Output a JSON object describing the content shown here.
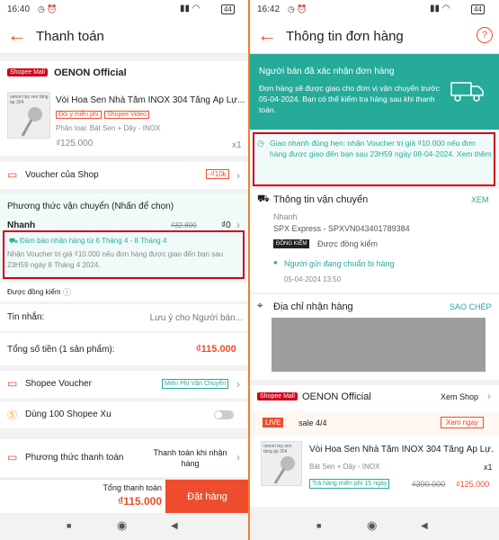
{
  "left": {
    "status_time": "16:40",
    "status_icons": "◷ ⏰",
    "battery": "44",
    "title": "Thanh toán",
    "shop": {
      "badge": "Shopee Mall",
      "name": "OENON Official"
    },
    "product": {
      "name": "Vòi Hoa Sen Nhà Tắm INOX 304 Tăng Áp Lự...",
      "tag1": "Đổi ý miễn phí",
      "tag2": "Shopee Video",
      "variant": "Phân loại: Bát Sen + Dây - INOX",
      "price": "₫125.000",
      "qty": "x1",
      "thumb_text": "oenon tay sen tăng áp 304"
    },
    "voucher_shop": {
      "label": "Voucher của Shop",
      "badge": "-₫10k"
    },
    "shipping": {
      "title": "Phương thức vận chuyển (Nhấn để chọn)",
      "method": "Nhanh",
      "old_price": "₫32.800",
      "price": "₫0",
      "guarantee": "Đảm bảo nhận hàng từ 6 Tháng 4 - 8 Tháng 4",
      "note": "Nhận Voucher trị giá ₫10.000 nếu đơn hàng được giao đến bạn sau 23H59 ngày 8 Tháng 4 2024."
    },
    "inspect": "Được đồng kiểm",
    "message": {
      "label": "Tin nhắn:",
      "placeholder": "Lưu ý cho Người bán..."
    },
    "total_line": {
      "label": "Tổng số tiền (1 sản phẩm):",
      "value": "₫115.000"
    },
    "shopee_voucher": {
      "label": "Shopee Voucher",
      "badge": "Miễn Phí Vận Chuyển"
    },
    "xu": {
      "label": "Dùng 100 Shopee Xu"
    },
    "payment": {
      "label": "Phương thức thanh toán",
      "value": "Thanh toán khi nhận hàng"
    },
    "bottom": {
      "total_label": "Tổng thanh toán",
      "total": "₫115.000",
      "order_btn": "Đặt hàng"
    }
  },
  "right": {
    "status_time": "16:42",
    "status_icons": "◷ ⏰",
    "battery": "44",
    "title": "Thông tin đơn hàng",
    "help": "?",
    "banner": {
      "title": "Người bán đã xác nhận đơn hàng",
      "text": "Đơn hàng sẽ được giao cho đơn vị vận chuyển trước 05-04-2024. Bạn có thể kiểm tra hàng sau khi thanh toán."
    },
    "guarantee": {
      "text": "Giao nhanh đúng hẹn: nhận Voucher trị giá ₫10.000 nếu đơn hàng được giao đến bạn sau 23H59 ngày 08-04-2024.",
      "link": "Xem thêm"
    },
    "shipping_info": {
      "title": "Thông tin vận chuyển",
      "action": "XEM",
      "method": "Nhanh",
      "carrier": "SPX Express - SPXVN043401789384",
      "inspect_badge": "ĐỒNG KIỂM",
      "inspect": "Được đồng kiểm",
      "status": "Người gửi đang chuẩn bị hàng",
      "time": "05-04-2024 13:50"
    },
    "address": {
      "title": "Địa chỉ nhận hàng",
      "action": "SAO CHÉP"
    },
    "shop": {
      "badge": "Shopee Mall",
      "name": "OENON Official",
      "view": "Xem Shop"
    },
    "live": {
      "badge": "LIVE",
      "text": "sale 4/4",
      "btn": "Xem ngay"
    },
    "product": {
      "name": "Vòi Hoa Sen Nhà Tắm INOX 304 Tăng Áp Lự...",
      "variant": "Bát Sen + Dây - INOX",
      "qty": "x1",
      "tag": "Trả hàng miễn phí 15 ngày",
      "old_price": "₫300.000",
      "price": "₫125.000",
      "thumb_text": "oenon tay sen tăng áp 304"
    }
  },
  "colors": {
    "accent": "#ee4d2d",
    "teal": "#26aa99",
    "highlight": "#d0011b"
  }
}
